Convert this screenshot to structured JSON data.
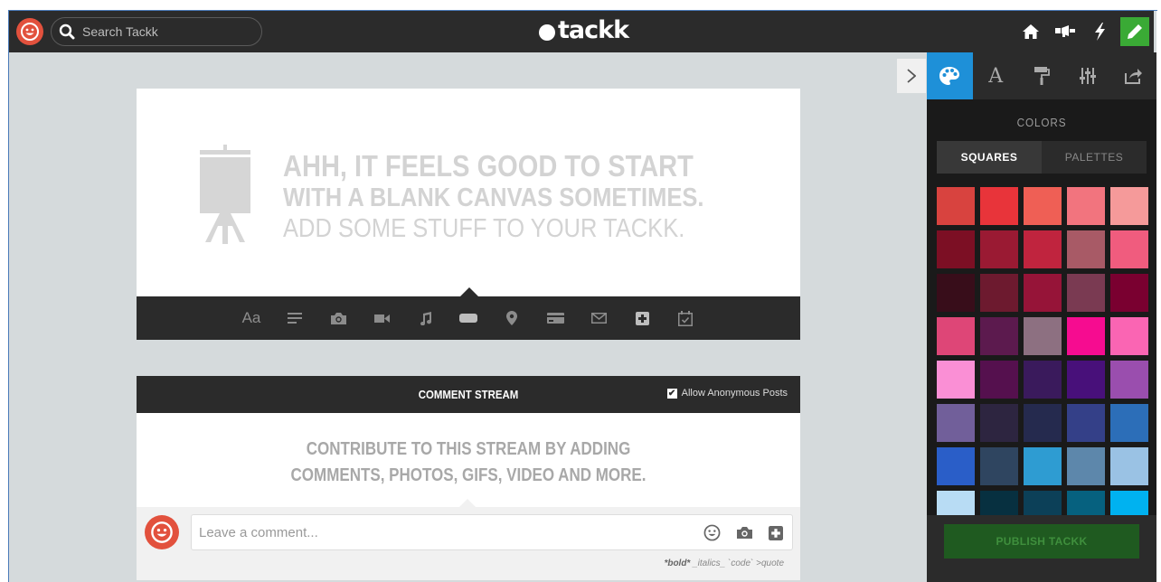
{
  "header": {
    "search_placeholder": "Search Tackk",
    "logo_text": "tackk",
    "icons": [
      "smiley-avatar-icon",
      "search-icon",
      "home-icon",
      "megaphone-icon",
      "lightning-icon",
      "pencil-icon"
    ],
    "accent_green": "#3aaa35"
  },
  "canvas": {
    "line1": "AHH, IT FEELS GOOD TO START",
    "line2": "WITH A BLANK CANVAS SOMETIMES.",
    "line3": "ADD SOME STUFF TO YOUR TACKK.",
    "toolbar": {
      "text_tool": "Aa",
      "tools": [
        "text-icon",
        "paragraph-icon",
        "camera-icon",
        "video-icon",
        "music-icon",
        "button-icon",
        "map-pin-icon",
        "card-icon",
        "email-icon",
        "plus-icon",
        "calendar-icon"
      ]
    }
  },
  "stream": {
    "title": "COMMENT STREAM",
    "allow_anonymous": "Allow Anonymous Posts",
    "message_line1": "CONTRIBUTE TO THIS STREAM BY ADDING",
    "message_line2": "COMMENTS, PHOTOS, GIFS, VIDEO AND MORE.",
    "comment_placeholder": "Leave a comment...",
    "format_bold": "*bold*",
    "format_rest": " _italics_ `code` >quote"
  },
  "panel": {
    "tabs": [
      "palette-icon",
      "font-icon",
      "paint-roller-icon",
      "sliders-icon",
      "share-icon"
    ],
    "active_tab_color": "#1e90d8",
    "colors_title": "COLORS",
    "seg_squares": "SQUARES",
    "seg_palettes": "PALETTES",
    "swatches": [
      "#d8433f",
      "#e8343a",
      "#ef5f55",
      "#f2747e",
      "#f59a9a",
      "#7c0f24",
      "#9a1a33",
      "#c0243e",
      "#a85a66",
      "#f05c7e",
      "#380d1a",
      "#6d1a2f",
      "#961438",
      "#7a3a52",
      "#7a0030",
      "#de4677",
      "#5c1a4e",
      "#8d7081",
      "#f60c90",
      "#fa65b3",
      "#fa8fd5",
      "#55104e",
      "#3a1a5c",
      "#48107a",
      "#9a4eae",
      "#715f9a",
      "#2d2540",
      "#252a4e",
      "#344088",
      "#2c6eb8",
      "#2a5ec8",
      "#2f4560",
      "#2e9cd2",
      "#5d87ab",
      "#9ac2e4",
      "#b8dcf4",
      "#073040",
      "#0c4058",
      "#06617f",
      "#00b2f0"
    ],
    "publish_label": "PUBLISH TACKK"
  }
}
